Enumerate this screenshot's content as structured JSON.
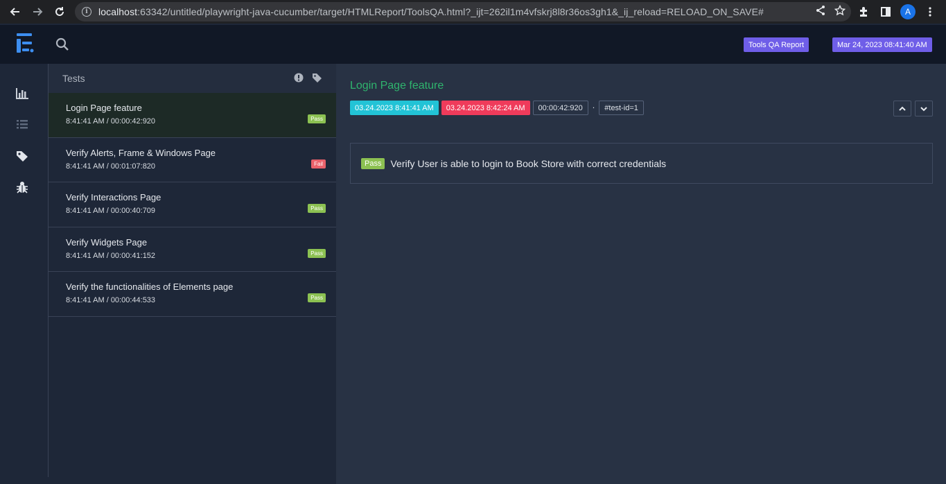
{
  "browser": {
    "url_host": "localhost",
    "url_rest": ":63342/untitled/playwright-java-cucumber/target/HTMLReport/ToolsQA.html?_ijt=262il1m4vfskrj8l8r36os3gh1&_ij_reload=RELOAD_ON_SAVE#",
    "profile_initial": "A"
  },
  "header": {
    "report_name": "Tools QA Report",
    "report_date": "Mar 24, 2023 08:41:40 AM"
  },
  "tests_panel": {
    "title": "Tests",
    "items": [
      {
        "name": "Login Page feature",
        "time": "8:41:41 AM / 00:00:42:920",
        "status": "Pass"
      },
      {
        "name": "Verify Alerts, Frame & Windows Page",
        "time": "8:41:41 AM / 00:01:07:820",
        "status": "Fail"
      },
      {
        "name": "Verify Interactions Page",
        "time": "8:41:41 AM / 00:00:40:709",
        "status": "Pass"
      },
      {
        "name": "Verify Widgets Page",
        "time": "8:41:41 AM / 00:00:41:152",
        "status": "Pass"
      },
      {
        "name": "Verify the functionalities of Elements page",
        "time": "8:41:41 AM / 00:00:44:533",
        "status": "Pass"
      }
    ]
  },
  "detail": {
    "title": "Login Page feature",
    "start": "03.24.2023 8:41:41 AM",
    "end": "03.24.2023 8:42:24 AM",
    "duration": "00:00:42:920",
    "separator": "·",
    "test_id": "#test-id=1",
    "scenario": {
      "status": "Pass",
      "name": "Verify User is able to login to Book Store with correct credentials"
    }
  },
  "colors": {
    "accent": "#6f5ee8",
    "pass": "#8cc152",
    "fail": "#e9616a",
    "start_tag": "#22c3d6",
    "end_tag": "#ef3b5b",
    "title_green": "#2fb56e"
  }
}
